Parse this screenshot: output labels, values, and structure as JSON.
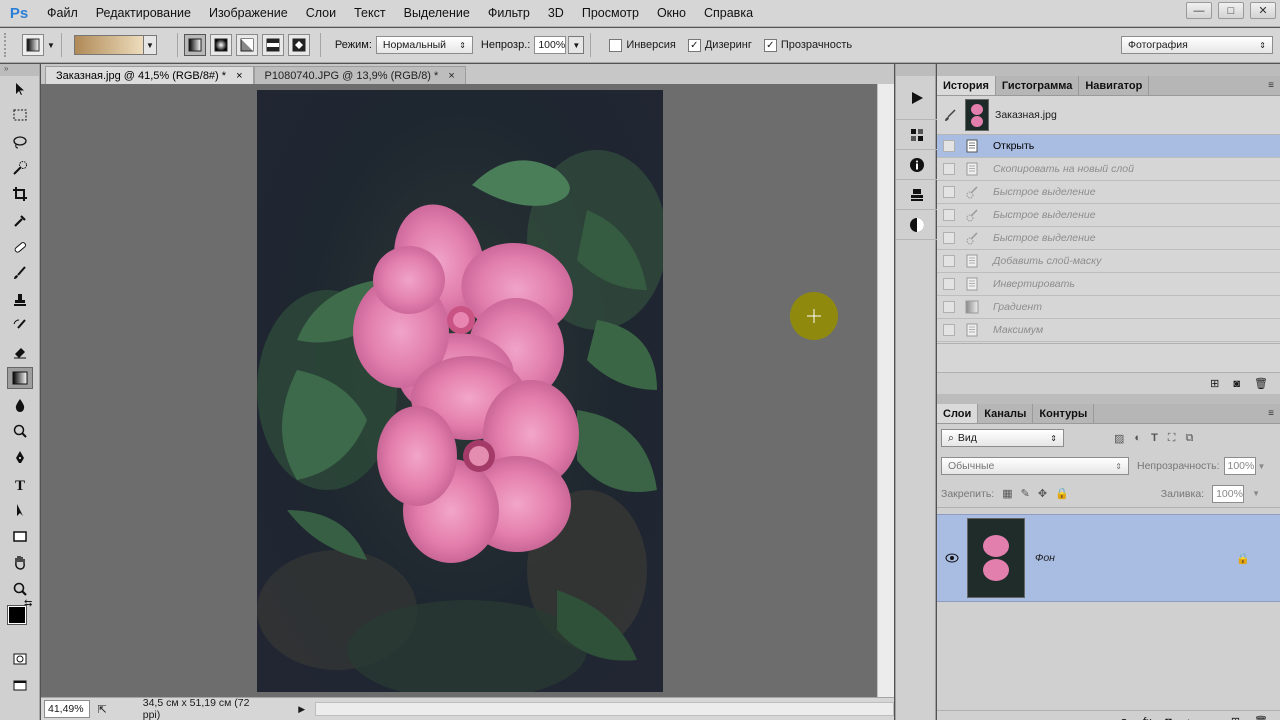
{
  "app": {
    "logo": "Ps"
  },
  "menu": [
    "Файл",
    "Редактирование",
    "Изображение",
    "Слои",
    "Текст",
    "Выделение",
    "Фильтр",
    "3D",
    "Просмотр",
    "Окно",
    "Справка"
  ],
  "window_controls": {
    "minimize": "—",
    "maximize": "□",
    "close": "✕"
  },
  "options": {
    "mode_label": "Режим:",
    "mode_value": "Нормальный",
    "opacity_label": "Непрозр.:",
    "opacity_value": "100%",
    "inverse_label": "Инверсия",
    "inverse_checked": false,
    "dither_label": "Дизеринг",
    "dither_checked": true,
    "transparency_label": "Прозрачность",
    "transparency_checked": true,
    "workspace_value": "Фотография",
    "check_glyph": "✓"
  },
  "tabs": [
    {
      "title": "Заказная.jpg @ 41,5% (RGB/8#) *",
      "close": "×"
    },
    {
      "title": "P1080740.JPG @ 13,9% (RGB/8) *",
      "close": "×"
    }
  ],
  "status": {
    "zoom": "41,49%",
    "doc_size": "34,5 см x 51,19 см (72 ppi)"
  },
  "history": {
    "tabs": [
      "История",
      "Гистограмма",
      "Навигатор"
    ],
    "snapshot_name": "Заказная.jpg",
    "items": [
      {
        "label": "Открыть",
        "icon": "document-icon",
        "active": true
      },
      {
        "label": "Скопировать на новый слой",
        "icon": "document-icon",
        "active": false
      },
      {
        "label": "Быстрое выделение",
        "icon": "brush-icon",
        "active": false
      },
      {
        "label": "Быстрое выделение",
        "icon": "brush-icon",
        "active": false
      },
      {
        "label": "Быстрое выделение",
        "icon": "brush-icon",
        "active": false
      },
      {
        "label": "Добавить слой-маску",
        "icon": "document-icon",
        "active": false
      },
      {
        "label": "Инвертировать",
        "icon": "document-icon",
        "active": false
      },
      {
        "label": "Градиент",
        "icon": "gradient-icon",
        "active": false
      },
      {
        "label": "Максимум",
        "icon": "document-icon",
        "active": false
      }
    ]
  },
  "layers": {
    "tabs": [
      "Слои",
      "Каналы",
      "Контуры"
    ],
    "filter_value": "Вид",
    "blend_value": "Обычные",
    "opacity_label": "Непрозрачность:",
    "opacity_value": "100%",
    "lock_label": "Закрепить:",
    "fill_label": "Заливка:",
    "fill_value": "100%",
    "items": [
      {
        "name": "Фон",
        "locked": true,
        "visible": true
      }
    ]
  },
  "colors": {
    "accent_selection": "#a9bde2",
    "flower_pink": "#e27fad",
    "leaf_green": "#3d6a4a",
    "cursor_marker": "#8f8a0d",
    "gradient_start": "#b08a57",
    "gradient_end": "#eddcbc"
  }
}
